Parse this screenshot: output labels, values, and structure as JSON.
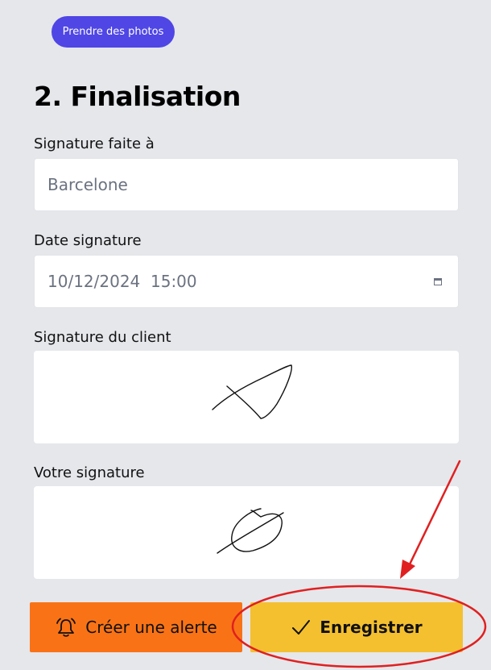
{
  "photos": {
    "label": "Prendre des photos"
  },
  "section": {
    "title": "2. Finalisation"
  },
  "signature_place": {
    "label": "Signature faite à",
    "value": "Barcelone"
  },
  "signature_date": {
    "label": "Date signature",
    "value": "10/12/2024  15:00"
  },
  "client_signature": {
    "label": "Signature du client"
  },
  "your_signature": {
    "label": "Votre signature"
  },
  "actions": {
    "alert_label": "Créer une alerte",
    "save_label": "Enregistrer"
  },
  "icons": {
    "alert": "bell-icon",
    "save": "checkmark-icon",
    "date": "calendar-icon"
  },
  "colors": {
    "photos_button": "#4f46e5",
    "alert_button": "#f97316",
    "save_button": "#f4c030",
    "annotation": "#e02020"
  }
}
